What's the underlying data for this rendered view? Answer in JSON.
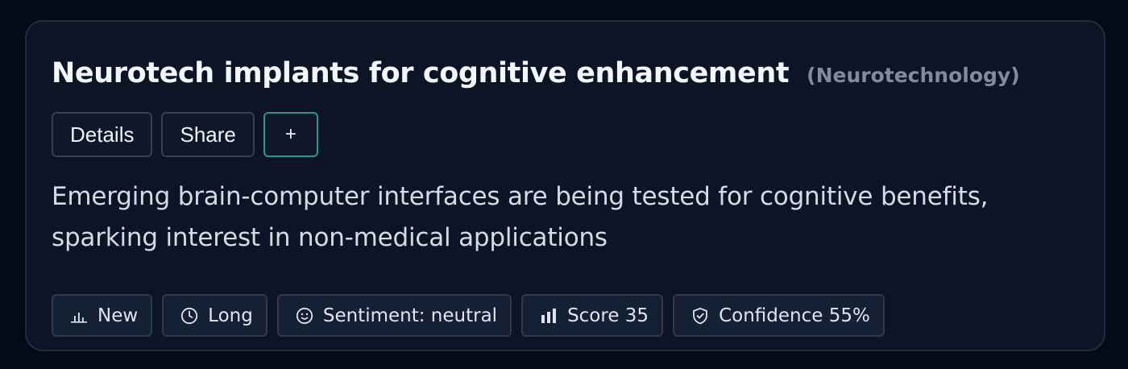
{
  "card": {
    "title": "Neurotech implants for cognitive enhancement",
    "category": "(Neurotechnology)",
    "description": "Emerging brain-computer interfaces are being tested for cognitive benefits, sparking interest in non-medical applications"
  },
  "actions": {
    "details_label": "Details",
    "share_label": "Share",
    "add_label": "+"
  },
  "chips": [
    {
      "icon": "bar-chart-low-icon",
      "label": "New"
    },
    {
      "icon": "clock-icon",
      "label": "Long"
    },
    {
      "icon": "smiley-face-icon",
      "label": "Sentiment: neutral"
    },
    {
      "icon": "bar-chart-icon",
      "label": "Score 35"
    },
    {
      "icon": "shield-check-icon",
      "label": "Confidence 55%"
    }
  ],
  "colors": {
    "background": "#050a17",
    "card": "#0c1426",
    "accent_border": "#2a9a82",
    "muted_text": "#7e8ba0"
  }
}
